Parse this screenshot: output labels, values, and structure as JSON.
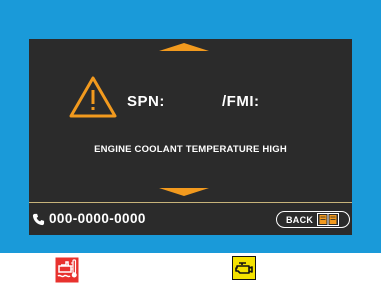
{
  "fault": {
    "spn_label": "SPN:",
    "fmi_label": "/FMI:",
    "message": "ENGINE COOLANT TEMPERATURE HIGH"
  },
  "footer": {
    "phone_number": "000-0000-0000",
    "back_label": "BACK"
  },
  "icons": {
    "nav_up": "triangle-up-icon",
    "nav_down": "triangle-down-icon",
    "warning": "warning-triangle-icon",
    "phone": "phone-icon",
    "book": "book-icon",
    "coolant_lamp": "coolant-temperature-icon",
    "engine_lamp": "check-engine-icon"
  },
  "colors": {
    "bezel": "#1a9ad9",
    "screen": "#2b2b2b",
    "accent": "#f29a1e",
    "coolant_lamp": "#e8322e",
    "engine_lamp": "#f4e200"
  }
}
